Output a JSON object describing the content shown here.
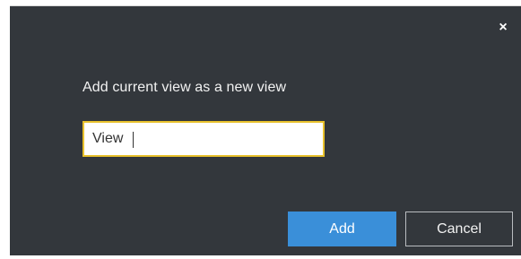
{
  "dialog": {
    "close_glyph": "×",
    "prompt": "Add current view as a new view",
    "input_value": "View",
    "add_label": "Add",
    "cancel_label": "Cancel"
  },
  "colors": {
    "background": "#33373c",
    "input_border": "#e8c12d",
    "primary_button": "#3a8fd9"
  },
  "icons": {
    "close": "close-icon"
  }
}
